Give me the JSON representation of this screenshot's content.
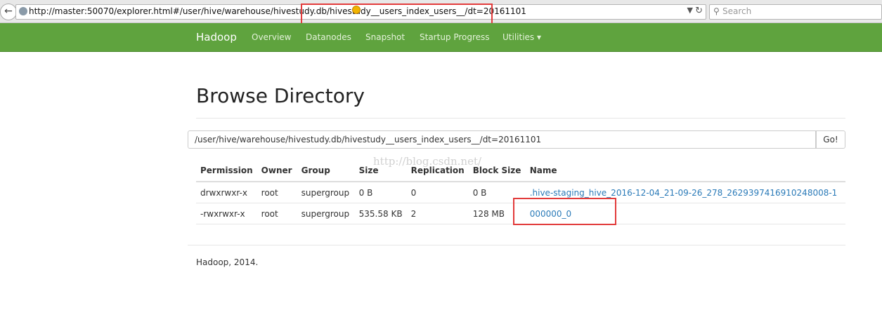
{
  "browser": {
    "url": "http://master:50070/explorer.html#/user/hive/warehouse/hivestudy.db/hivestudy__users_index_users__/dt=20161101",
    "search_placeholder": "Search",
    "back_icon": "back-arrow-icon",
    "reload_icon": "reload-icon"
  },
  "navbar": {
    "brand": "Hadoop",
    "items": [
      "Overview",
      "Datanodes",
      "Snapshot",
      "Startup Progress",
      "Utilities ▾"
    ],
    "bg_color": "#5fa33e"
  },
  "main": {
    "title": "Browse Directory",
    "path": "/user/hive/warehouse/hivestudy.db/hivestudy__users_index_users__/dt=20161101",
    "go_label": "Go!"
  },
  "table": {
    "headers": [
      "Permission",
      "Owner",
      "Group",
      "Size",
      "Replication",
      "Block Size",
      "Name"
    ],
    "rows": [
      [
        "drwxrwxr-x",
        "root",
        "supergroup",
        "0 B",
        "0",
        "0 B",
        ".hive-staging_hive_2016-12-04_21-09-26_278_2629397416910248008-1"
      ],
      [
        "-rwxrwxr-x",
        "root",
        "supergroup",
        "535.58 KB",
        "2",
        "128 MB",
        "000000_0"
      ]
    ]
  },
  "watermark": "http://blog.csdn.net/",
  "footer": "Hadoop, 2014.",
  "highlight_color": "#e23b3b"
}
